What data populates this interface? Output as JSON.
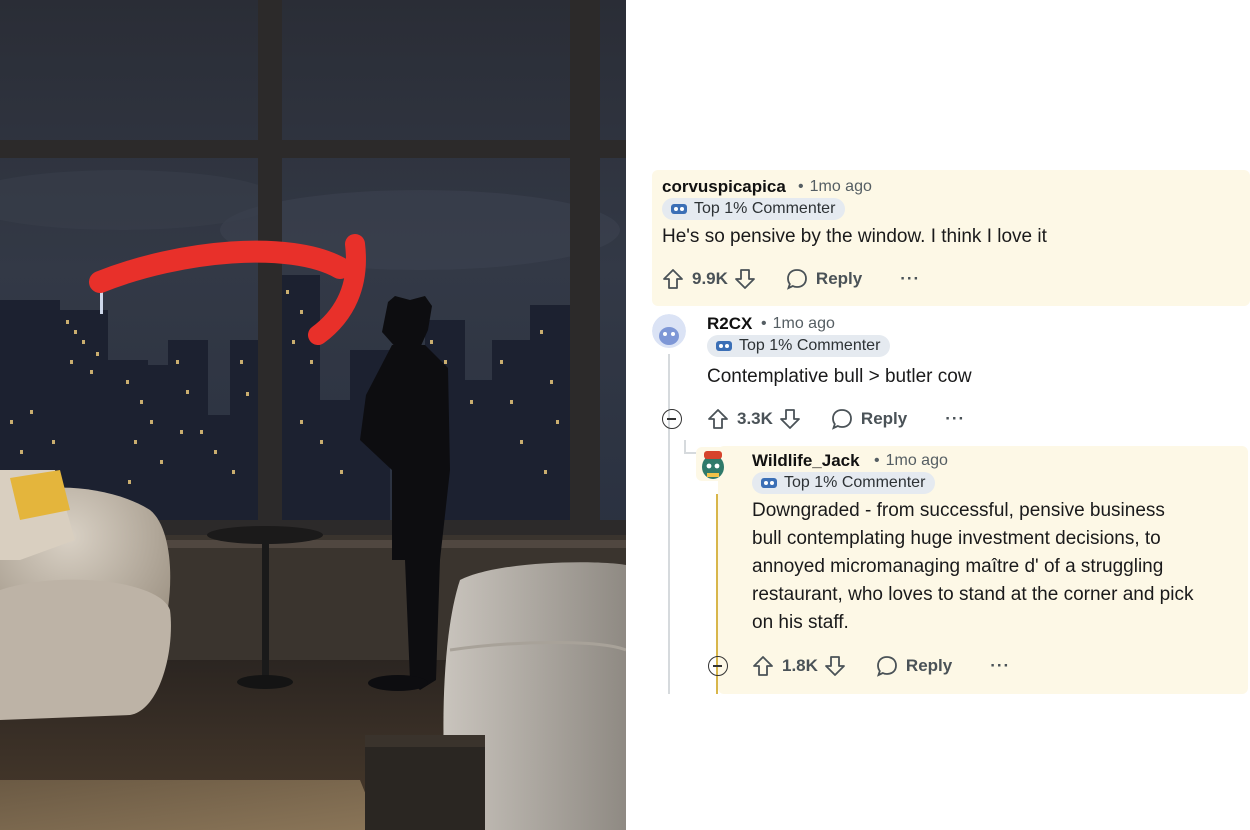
{
  "comments": [
    {
      "username": "corvuspicapica",
      "time": "1mo ago",
      "badge": "Top 1% Commenter",
      "body": [
        "He's so pensive by the window. I think I love it"
      ],
      "votes": "9.9K",
      "reply_label": "Reply",
      "more_label": "···"
    },
    {
      "username": "R2CX",
      "time": "1mo ago",
      "badge": "Top 1% Commenter",
      "body": [
        "Contemplative bull > butler cow"
      ],
      "votes": "3.3K",
      "reply_label": "Reply",
      "more_label": "···"
    },
    {
      "username": "Wildlife_Jack",
      "time": "1mo ago",
      "badge": "Top 1% Commenter",
      "body": [
        "Downgraded - from successful, pensive business",
        "bull contemplating huge investment decisions, to",
        "annoyed micromanaging maître d' of a struggling",
        "restaurant, who loves to stand at the corner and pick",
        "on his staff."
      ],
      "votes": "1.8K",
      "reply_label": "Reply",
      "more_label": "···"
    }
  ],
  "separator": "•",
  "colors": {
    "highlight_bg": "#fdf8e6",
    "badge_bg": "#e5eaf0",
    "arrow": "#e8302a",
    "thread_line": "#d6dadd",
    "thread_line_active": "#d8b64a"
  },
  "icons": [
    "upvote-icon",
    "downvote-icon",
    "reply-bubble-icon",
    "more-icon",
    "collapse-icon",
    "commenter-badge-icon"
  ]
}
